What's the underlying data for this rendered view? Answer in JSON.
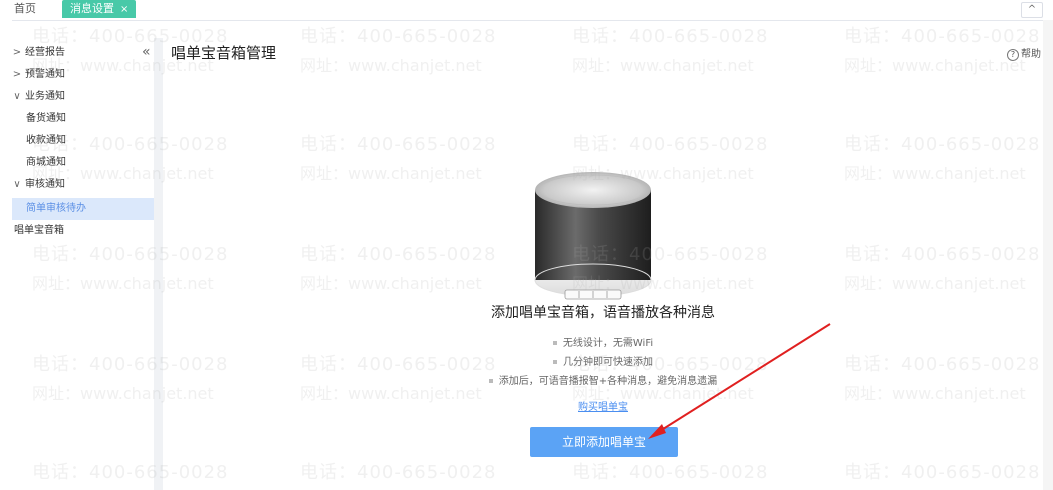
{
  "tabs": {
    "home": "首页",
    "active": "消息设置",
    "active_close": "×",
    "collapse": "^"
  },
  "sidebar": {
    "collapse_icon": "«",
    "items": [
      {
        "label": "经营报告",
        "arrow": ">"
      },
      {
        "label": "预警通知",
        "arrow": ">"
      },
      {
        "label": "业务通知",
        "arrow": "∨"
      },
      {
        "label": "备货通知"
      },
      {
        "label": "收款通知"
      },
      {
        "label": "商城通知"
      },
      {
        "label": "审核通知",
        "arrow": "∨"
      },
      {
        "label": "简单审核待办",
        "active": true
      },
      {
        "label": "唱单宝音箱"
      }
    ]
  },
  "header": {
    "title": "唱单宝音箱管理",
    "help": "帮助",
    "help_icon": "?"
  },
  "main": {
    "headline": "添加唱单宝音箱，语音播放各种消息",
    "features": [
      "无线设计，无需WiFi",
      "几分钟即可快速添加",
      "添加后，可语音播报智+各种消息，避免消息遗漏"
    ],
    "buy_link": "购买唱单宝",
    "add_button": "立即添加唱单宝"
  },
  "watermark": {
    "phone": "电话：400-665-0028",
    "site": "网址：www.chanjet.net"
  },
  "colors": {
    "tab_active": "#48c9a8",
    "button": "#5ba3f5",
    "link": "#4a8ef0",
    "nav_active_bg": "#dbe8fb",
    "arrow": "#e02020"
  }
}
